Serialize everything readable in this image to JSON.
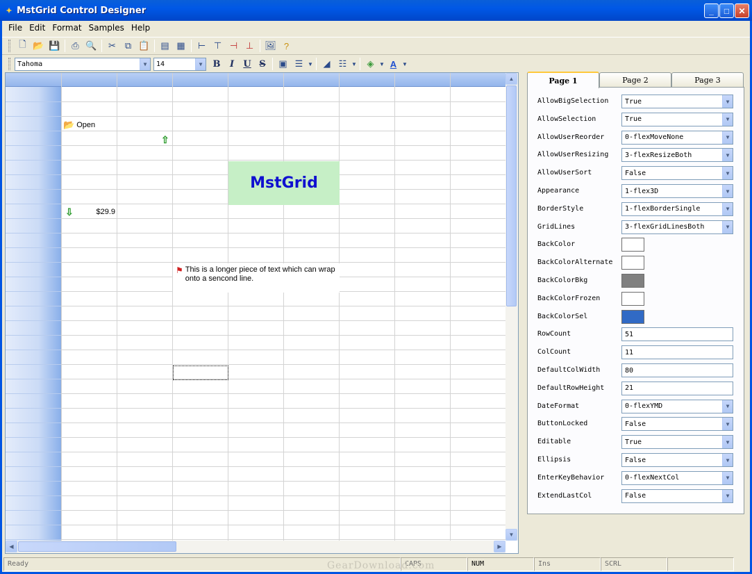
{
  "window": {
    "title": "MstGrid Control Designer",
    "minimize": "_",
    "maximize": "□",
    "close": "✕"
  },
  "menu": [
    "File",
    "Edit",
    "Format",
    "Samples",
    "Help"
  ],
  "toolbar1": [
    "new-icon",
    "open-icon",
    "save-icon",
    "print-icon",
    "print-preview-icon",
    "cut-icon",
    "copy-icon",
    "paste-icon",
    "grid-icon",
    "table-icon",
    "insert-row-icon",
    "insert-col-icon",
    "delete-row-icon",
    "delete-col-icon",
    "picture-icon",
    "help-icon"
  ],
  "toolbar2": {
    "font": "Tahoma",
    "size": "14",
    "bold": "B",
    "italic": "I",
    "underline": "U",
    "strike": "S"
  },
  "grid": {
    "cells": {
      "open_text": "Open",
      "price_text": "$29.9",
      "mstgrid_text": "MstGrid",
      "wrap_text": "This is a longer piece of text which can wrap onto a sencond line."
    }
  },
  "panel": {
    "tabs": [
      "Page 1",
      "Page 2",
      "Page 3"
    ],
    "active_tab": 0,
    "properties": [
      {
        "name": "AllowBigSelection",
        "type": "combo",
        "value": "True"
      },
      {
        "name": "AllowSelection",
        "type": "combo",
        "value": "True"
      },
      {
        "name": "AllowUserReorder",
        "type": "combo",
        "value": "0-flexMoveNone"
      },
      {
        "name": "AllowUserResizing",
        "type": "combo",
        "value": "3-flexResizeBoth"
      },
      {
        "name": "AllowUserSort",
        "type": "combo",
        "value": "False"
      },
      {
        "name": "Appearance",
        "type": "combo",
        "value": "1-flex3D"
      },
      {
        "name": "BorderStyle",
        "type": "combo",
        "value": "1-flexBorderSingle"
      },
      {
        "name": "GridLines",
        "type": "combo",
        "value": "3-flexGridLinesBoth"
      },
      {
        "name": "BackColor",
        "type": "color",
        "value": "#ffffff"
      },
      {
        "name": "BackColorAlternate",
        "type": "color",
        "value": "#ffffff"
      },
      {
        "name": "BackColorBkg",
        "type": "color",
        "value": "#808080"
      },
      {
        "name": "BackColorFrozen",
        "type": "color",
        "value": "#ffffff"
      },
      {
        "name": "BackColorSel",
        "type": "color",
        "value": "#316ac5"
      },
      {
        "name": "RowCount",
        "type": "text",
        "value": "51"
      },
      {
        "name": "ColCount",
        "type": "text",
        "value": "11"
      },
      {
        "name": "DefaultColWidth",
        "type": "text",
        "value": "80"
      },
      {
        "name": "DefaultRowHeight",
        "type": "text",
        "value": "21"
      },
      {
        "name": "DateFormat",
        "type": "combo",
        "value": "0-flexYMD"
      },
      {
        "name": "ButtonLocked",
        "type": "combo",
        "value": "False"
      },
      {
        "name": "Editable",
        "type": "combo",
        "value": "True"
      },
      {
        "name": "Ellipsis",
        "type": "combo",
        "value": "False"
      },
      {
        "name": "EnterKeyBehavior",
        "type": "combo",
        "value": "0-flexNextCol"
      },
      {
        "name": "ExtendLastCol",
        "type": "combo",
        "value": "False"
      }
    ]
  },
  "status": {
    "ready": "Ready",
    "caps": "CAPS",
    "num": "NUM",
    "ins": "Ins",
    "scrl": "SCRL"
  },
  "watermark": "GearDownload.com"
}
